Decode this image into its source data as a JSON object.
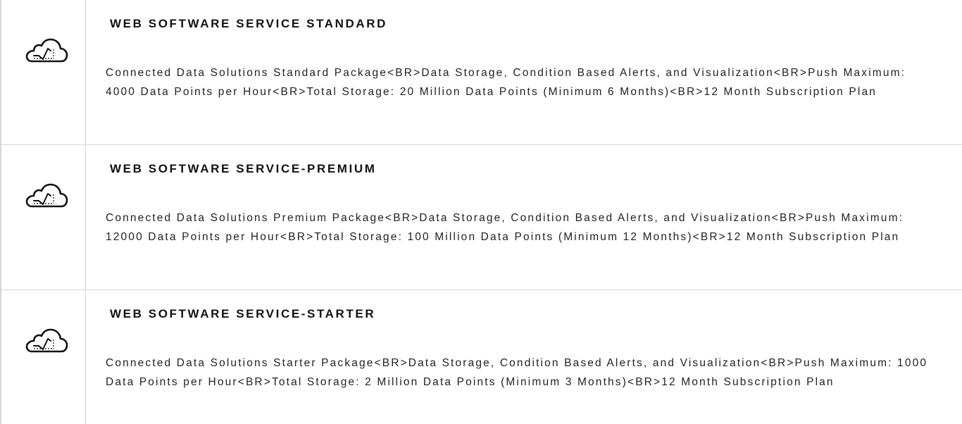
{
  "products": [
    {
      "icon": "cloud-chart-icon",
      "title": "WEB SOFTWARE SERVICE STANDARD",
      "description": "Connected Data Solutions Standard Package<BR>Data Storage, Condition Based Alerts, and Visualization<BR>Push Maximum: 4000 Data Points per Hour<BR>Total Storage: 20 Million Data Points (Minimum 6 Months)<BR>12 Month Subscription Plan"
    },
    {
      "icon": "cloud-chart-icon",
      "title": "WEB SOFTWARE SERVICE-PREMIUM",
      "description": "Connected Data Solutions Premium Package<BR>Data Storage, Condition Based Alerts, and Visualization<BR>Push Maximum: 12000 Data Points per Hour<BR>Total Storage: 100 Million Data Points (Minimum 12 Months)<BR>12 Month Subscription Plan"
    },
    {
      "icon": "cloud-chart-icon",
      "title": "WEB SOFTWARE SERVICE-STARTER",
      "description": "Connected Data Solutions Starter Package<BR>Data Storage, Condition Based Alerts, and Visualization<BR>Push Maximum: 1000 Data Points per Hour<BR>Total Storage: 2 Million Data Points (Minimum 3 Months)<BR>12 Month Subscription Plan"
    }
  ]
}
